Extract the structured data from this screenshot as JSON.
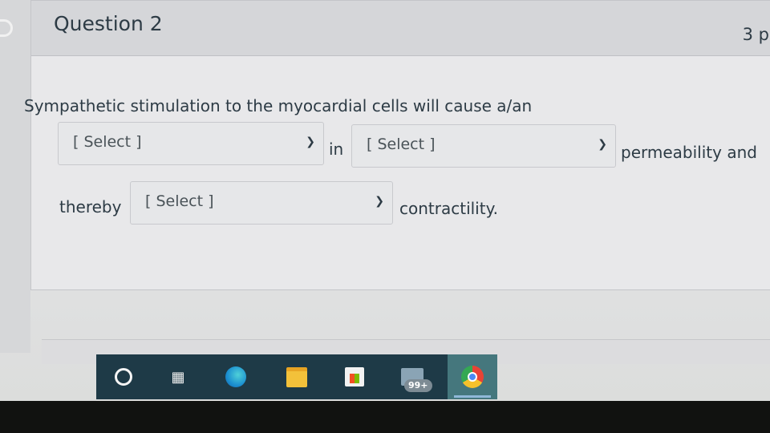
{
  "question": {
    "title": "Question 2",
    "points": "3 p"
  },
  "prompt": "Sympathetic stimulation to the myocardial cells will cause a/an",
  "dropdowns": [
    {
      "selected": "[ Select ]"
    },
    {
      "selected": "[ Select ]"
    },
    {
      "selected": "[ Select ]"
    }
  ],
  "text": {
    "in": "in",
    "permeability": "permeability and",
    "thereby": "thereby",
    "contractility": "contractility."
  },
  "taskbar": {
    "icons": [
      "cortana-icon",
      "task-view-icon",
      "edge-icon",
      "file-explorer-icon",
      "store-icon",
      "mail-icon",
      "chrome-icon"
    ],
    "mail_badge": "99+",
    "accent": "#1e3a47"
  },
  "chevron_glyph": "⌄"
}
